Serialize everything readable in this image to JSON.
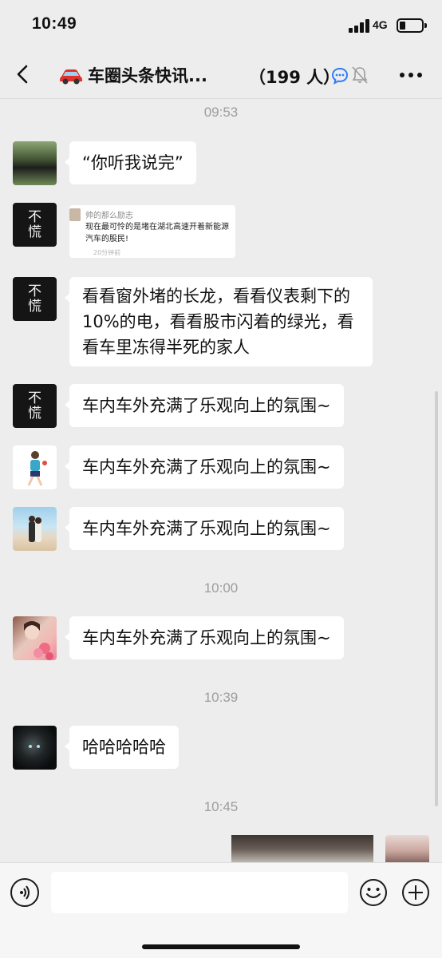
{
  "status_bar": {
    "time": "10:49",
    "network": "4G"
  },
  "header": {
    "title": "车圈头条快讯...",
    "member_count": "（199 人）"
  },
  "messages": [
    {
      "type": "time",
      "text": "09:53"
    },
    {
      "type": "text",
      "avatar": "cows-photo",
      "text": "“你听我说完”"
    },
    {
      "type": "card",
      "avatar": "calligraphy",
      "card": {
        "sender": "帅的那么励志",
        "text": "现在最可怜的是堵在湖北高速开着新能源汽车的股民!",
        "time": "20分钟前"
      }
    },
    {
      "type": "text",
      "avatar": "calligraphy",
      "text": "看看窗外堵的长龙，看看仪表剩下的10%的电，看看股市闪着的绿光，看看车里冻得半死的家人"
    },
    {
      "type": "text",
      "avatar": "calligraphy",
      "text": "车内车外充满了乐观向上的氛围~"
    },
    {
      "type": "text",
      "avatar": "runner",
      "text": "车内车外充满了乐观向上的氛围~"
    },
    {
      "type": "text",
      "avatar": "beach-couple",
      "text": "车内车外充满了乐观向上的氛围~"
    },
    {
      "type": "time",
      "text": "10:00"
    },
    {
      "type": "text",
      "avatar": "woman-flowers",
      "text": "车内车外充满了乐观向上的氛围~"
    },
    {
      "type": "time",
      "text": "10:39"
    },
    {
      "type": "text",
      "avatar": "dark-creature",
      "text": "哈哈哈哈哈"
    },
    {
      "type": "time",
      "text": "10:45"
    },
    {
      "type": "image-outgoing",
      "avatar": "self-portrait"
    }
  ],
  "avatar_calligraphy_chars": [
    "不",
    "慌"
  ],
  "input": {
    "placeholder": ""
  },
  "colors": {
    "background": "#ededed",
    "bubble": "#ffffff",
    "time_text": "#9d9d9d",
    "chat_status_blue": "#2f7cf6"
  },
  "icons": [
    "back-chevron-icon",
    "car-icon",
    "chat-status-icon",
    "mute-bell-icon",
    "more-dots-icon",
    "voice-icon",
    "emoji-icon",
    "plus-icon"
  ]
}
